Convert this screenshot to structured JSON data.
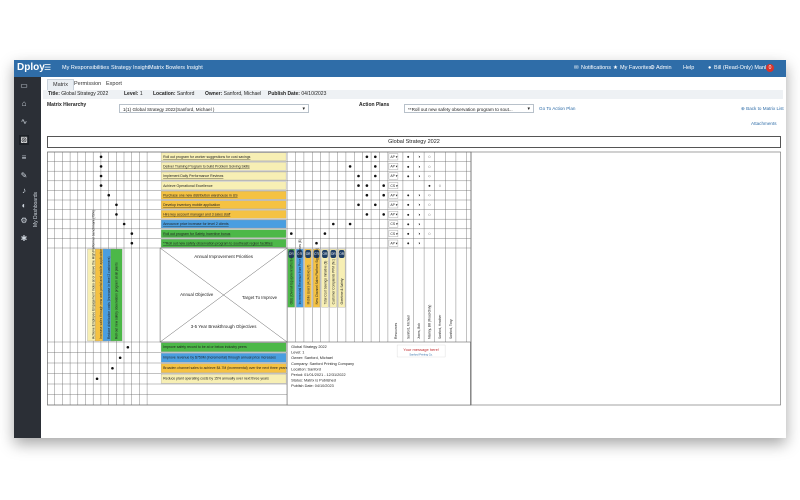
{
  "brand": {
    "logo": "Dploy",
    "menu_icon": "hamburger-icon"
  },
  "topnav": {
    "items": [
      "My Responsibilities",
      "Strategy Insight",
      "Matrix Bowlers Insight"
    ]
  },
  "topright": {
    "notifications": "Notifications",
    "favorites": "My Favorites",
    "admin": "Admin",
    "help": "Help",
    "user": "Bill (Read-Only) Manley",
    "badge": "0"
  },
  "sidebar": {
    "icons": [
      "monitor-icon",
      "home-icon",
      "chart-line-icon",
      "dashboard-icon",
      "list-icon",
      "edit-icon",
      "bell-icon",
      "toggle-icon",
      "gear-icon",
      "settings-icon"
    ],
    "vertical_label": "My Dashboards"
  },
  "tabs": [
    "Matrix",
    "Permission",
    "Export"
  ],
  "title_bar": {
    "title_label": "Title:",
    "title": "Global Strategy 2022",
    "level_label": "Level:",
    "level": "1",
    "location_label": "Location:",
    "location": "Sanford",
    "owner_label": "Owner:",
    "owner": "Sanford, Michael",
    "publish_label": "Publish Date:",
    "publish_date": "04/10/2023"
  },
  "controls": {
    "hierarchy_label": "Matrix Hierarchy",
    "hierarchy_value": "1(1) Global Strategy 2022(Sanford, Michael )",
    "action_label": "Action Plans",
    "action_value": "**Roll out new safety observation program to sout...",
    "goto": "Go To Action Plan",
    "back": "Back to Matrix List",
    "attachments": "Attachments"
  },
  "matrix": {
    "header": "Global Strategy 2022",
    "improvement_priorities": [
      {
        "text": "Roll out program for worker suggestions for cost savings",
        "color": "#f7efb4",
        "status": "AP"
      },
      {
        "text": "Deliver Training Program to build Problem Solving Skills",
        "color": "#f7efb4",
        "status": "AP"
      },
      {
        "text": "Implement Daily Performance Reviews",
        "color": "#f7efb4",
        "status": "AP"
      },
      {
        "text": "Achieve Operational Excellence",
        "color": "#f7efb4",
        "status": "CS"
      },
      {
        "text": "Purchase one new distribution warehouse in US",
        "color": "#f5c242",
        "status": "AP"
      },
      {
        "text": "Develop inventory mobile application",
        "color": "#f5c242",
        "status": "AP"
      },
      {
        "text": "Hire key account manager and 3 sales staff",
        "color": "#f5c242",
        "status": "AP"
      },
      {
        "text": "Announce price increase for level 2 clients",
        "color": "#4a9ee0",
        "status": "CS"
      },
      {
        "text": "Roll out program for Safety Incentive bonus",
        "color": "#4cb848",
        "status": "CS"
      },
      {
        "text": "**Roll out new safety observation program to southeast region facilities",
        "color": "#4cb848",
        "status": "AP"
      }
    ],
    "annual_objectives": [
      {
        "text": "Achieve Employee Engagement Index at or above the High Performer benchmark (75%)",
        "color": "#f7efb4"
      },
      {
        "text": "Increase sales through new web portal and mobile application",
        "color": "#f5c242"
      },
      {
        "text": "Reduce distribution costs (increase in level 2 customers)",
        "color": "#4a9ee0"
      },
      {
        "text": "Roll out new safety observation program at all plants",
        "color": "#4cb848"
      }
    ],
    "breakthroughs": [
      {
        "text": "Improve safety record to be at or below industry peers",
        "color": "#4cb848"
      },
      {
        "text": "Improve revenue by $750M (incremental) through annual price increases",
        "color": "#4a9ee0"
      },
      {
        "text": "Broaden channel sales to achieve $4.7M (incremental) over the next three years",
        "color": "#f5c242"
      },
      {
        "text": "Reduce plant operating costs by 15% annually over next three years",
        "color": "#f7efb4"
      }
    ],
    "center": {
      "top": "Annual Improvement Priorities",
      "left": "Annual Objective",
      "right": "Target To Improve",
      "bottom": "3-5 Year Breakthrough Objectives"
    },
    "targets": [
      {
        "badge": "OR",
        "text": "OEE (Overall Equipment Effectiveness)",
        "color": "#4cb848"
      },
      {
        "badge": "OR",
        "text": "Incremental Revenue from Price Increases ($)",
        "color": "#4a9ee0"
      },
      {
        "badge": "OR",
        "text": "Mobile Users (Ac/Active) (#)",
        "color": "#f5c242"
      },
      {
        "badge": "OR",
        "text": "New Channel Sales Platform Signed (#)",
        "color": "#f5c242"
      },
      {
        "badge": "OR",
        "text": "Total Cost Savings Initiative ($)",
        "color": "#f7efb4"
      },
      {
        "badge": "OR",
        "text": "Customer Complaints PPM (Nc)",
        "color": "#f7efb4"
      },
      {
        "badge": "OR",
        "text": "Overtime & Safety",
        "color": "#f7efb4"
      }
    ],
    "resources_label": "Resources",
    "resources": [
      "Sanford, Michael",
      "Jones, Bob",
      "Manley, Bill (Read-Only)",
      "Sanford, Heather",
      "Sanford, Tony"
    ],
    "info": {
      "title": "Global Strategy 2022",
      "level": "Level: 1",
      "owner": "Owner: Sanford, Michael",
      "company": "Company: Sanford Printing Company",
      "location": "Location: Sanford",
      "period": "Period: 01/01/2021 - 12/31/2022",
      "status": "Status: Matrix is Published",
      "publish": "Publish Date: 04/10/2023"
    },
    "logo_text": "Your message here!",
    "logo_sub": "Sanford Printing Co."
  }
}
